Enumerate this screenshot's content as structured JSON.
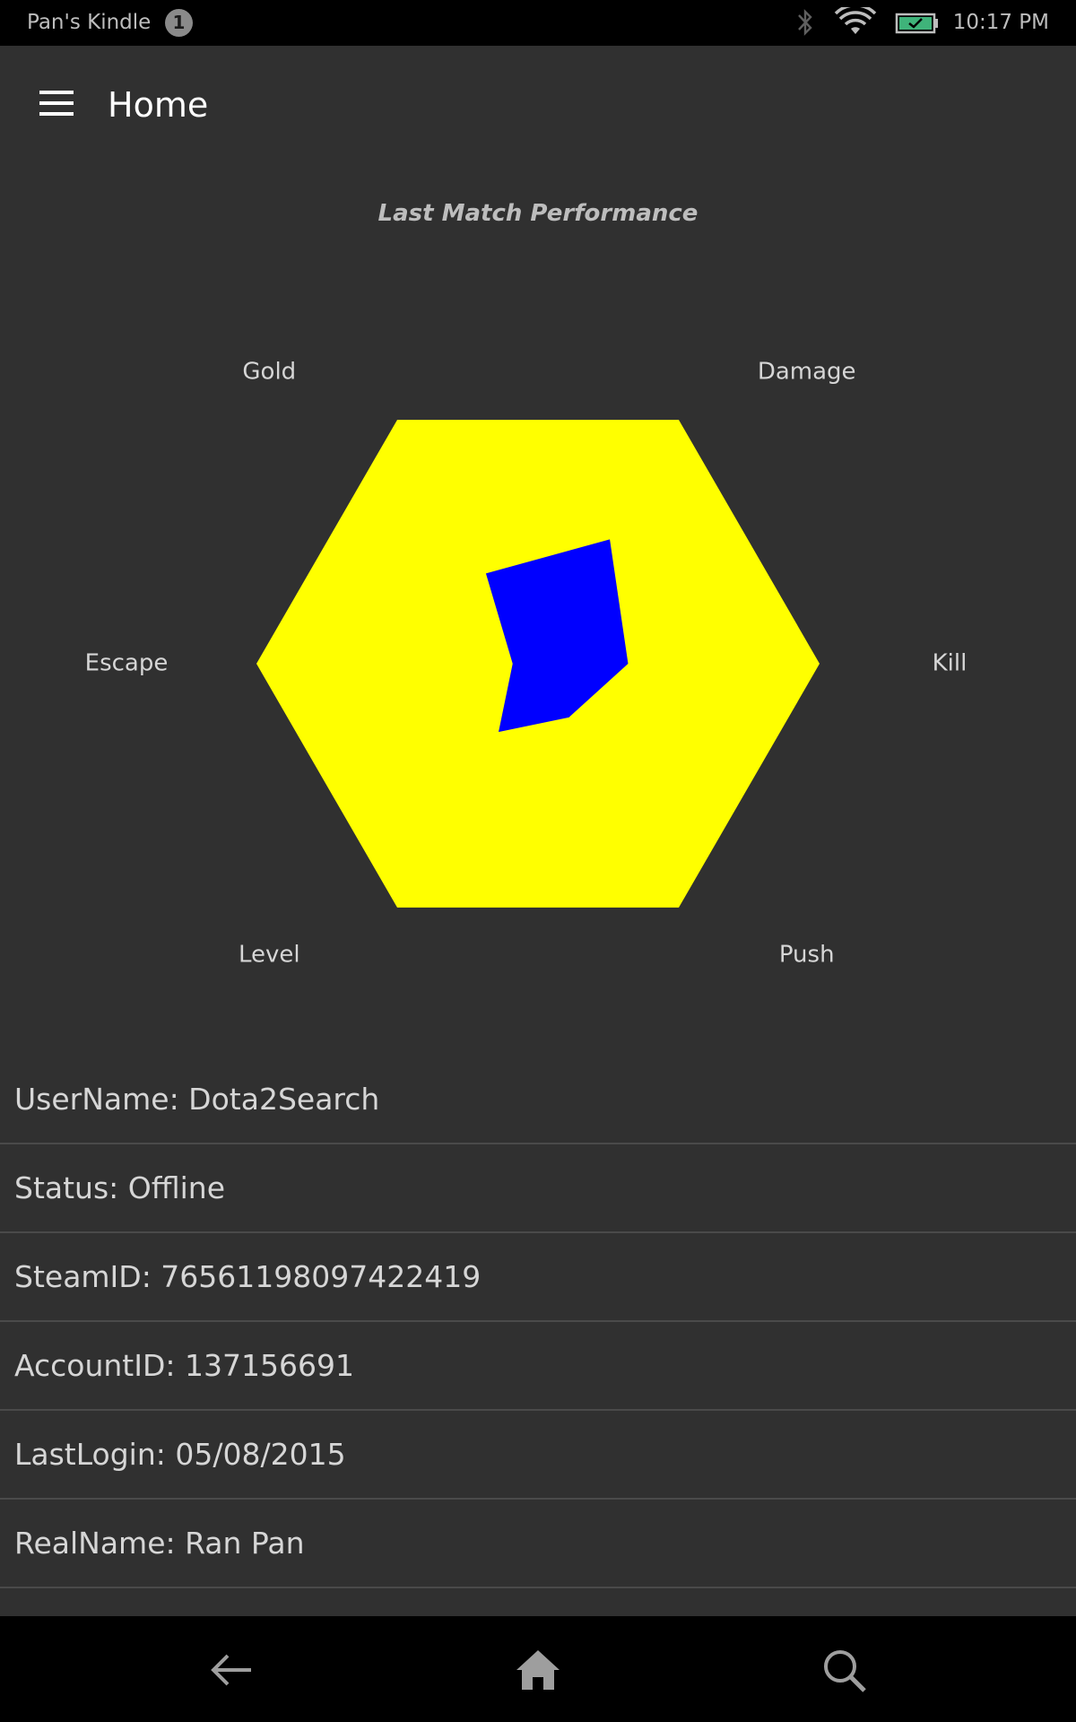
{
  "status_bar": {
    "device_name": "Pan's Kindle",
    "notification_count": "1",
    "time": "10:17 PM",
    "icons": [
      "bluetooth-icon",
      "wifi-icon",
      "battery-icon"
    ]
  },
  "app_bar": {
    "title": "Home",
    "menu_icon": "hamburger-menu-icon"
  },
  "chart_data": {
    "type": "radar",
    "title": "Last Match Performance",
    "axes": [
      "Kill",
      "Damage",
      "Gold",
      "Escape",
      "Level",
      "Push"
    ],
    "max": 1.0,
    "values": [
      0.32,
      0.51,
      0.37,
      0.09,
      0.28,
      0.22
    ],
    "background_color": "#FFFF00",
    "series_color": "#0000FF"
  },
  "info_rows": [
    "UserName: Dota2Search",
    "Status: Offline",
    "SteamID: 76561198097422419",
    "AccountID: 137156691",
    "LastLogin: 05/08/2015",
    "RealName: Ran Pan"
  ],
  "nav_bar": {
    "icons": [
      "back-arrow-icon",
      "home-icon",
      "search-icon"
    ]
  }
}
